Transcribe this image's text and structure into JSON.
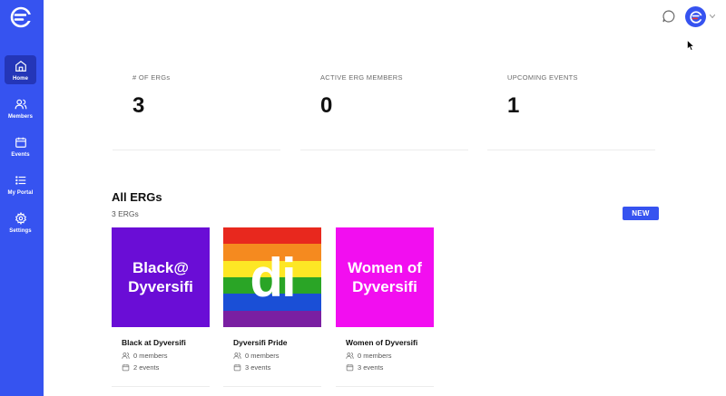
{
  "sidebar": {
    "items": [
      {
        "label": "Home"
      },
      {
        "label": "Members"
      },
      {
        "label": "Events"
      },
      {
        "label": "My Portal"
      },
      {
        "label": "Settings"
      }
    ]
  },
  "stats": [
    {
      "label": "# OF ERGs",
      "value": "3"
    },
    {
      "label": "ACTIVE ERG MEMBERS",
      "value": "0"
    },
    {
      "label": "UPCOMING EVENTS",
      "value": "1"
    }
  ],
  "section": {
    "title": "All ERGs",
    "count": "3 ERGs",
    "new_label": "NEW"
  },
  "cards": [
    {
      "image_text": "Black@ Dyversifi",
      "image_color": "#6a0dd6",
      "name": "Black at Dyversifi",
      "members": "0 members",
      "events": "2 events"
    },
    {
      "image_text": "di",
      "name": "Dyversifi Pride",
      "members": "0 members",
      "events": "3 events"
    },
    {
      "image_text": "Women of Dyversifi",
      "image_color": "#f20ef0",
      "name": "Women of Dyversifi",
      "members": "0 members",
      "events": "3 events"
    }
  ],
  "colors": {
    "brand": "#3653f0",
    "sidebar_active": "#2436b8",
    "rainbow": [
      "#e8281e",
      "#f58a1f",
      "#fde725",
      "#2aa526",
      "#1a4fd6",
      "#7a1fa2"
    ]
  }
}
